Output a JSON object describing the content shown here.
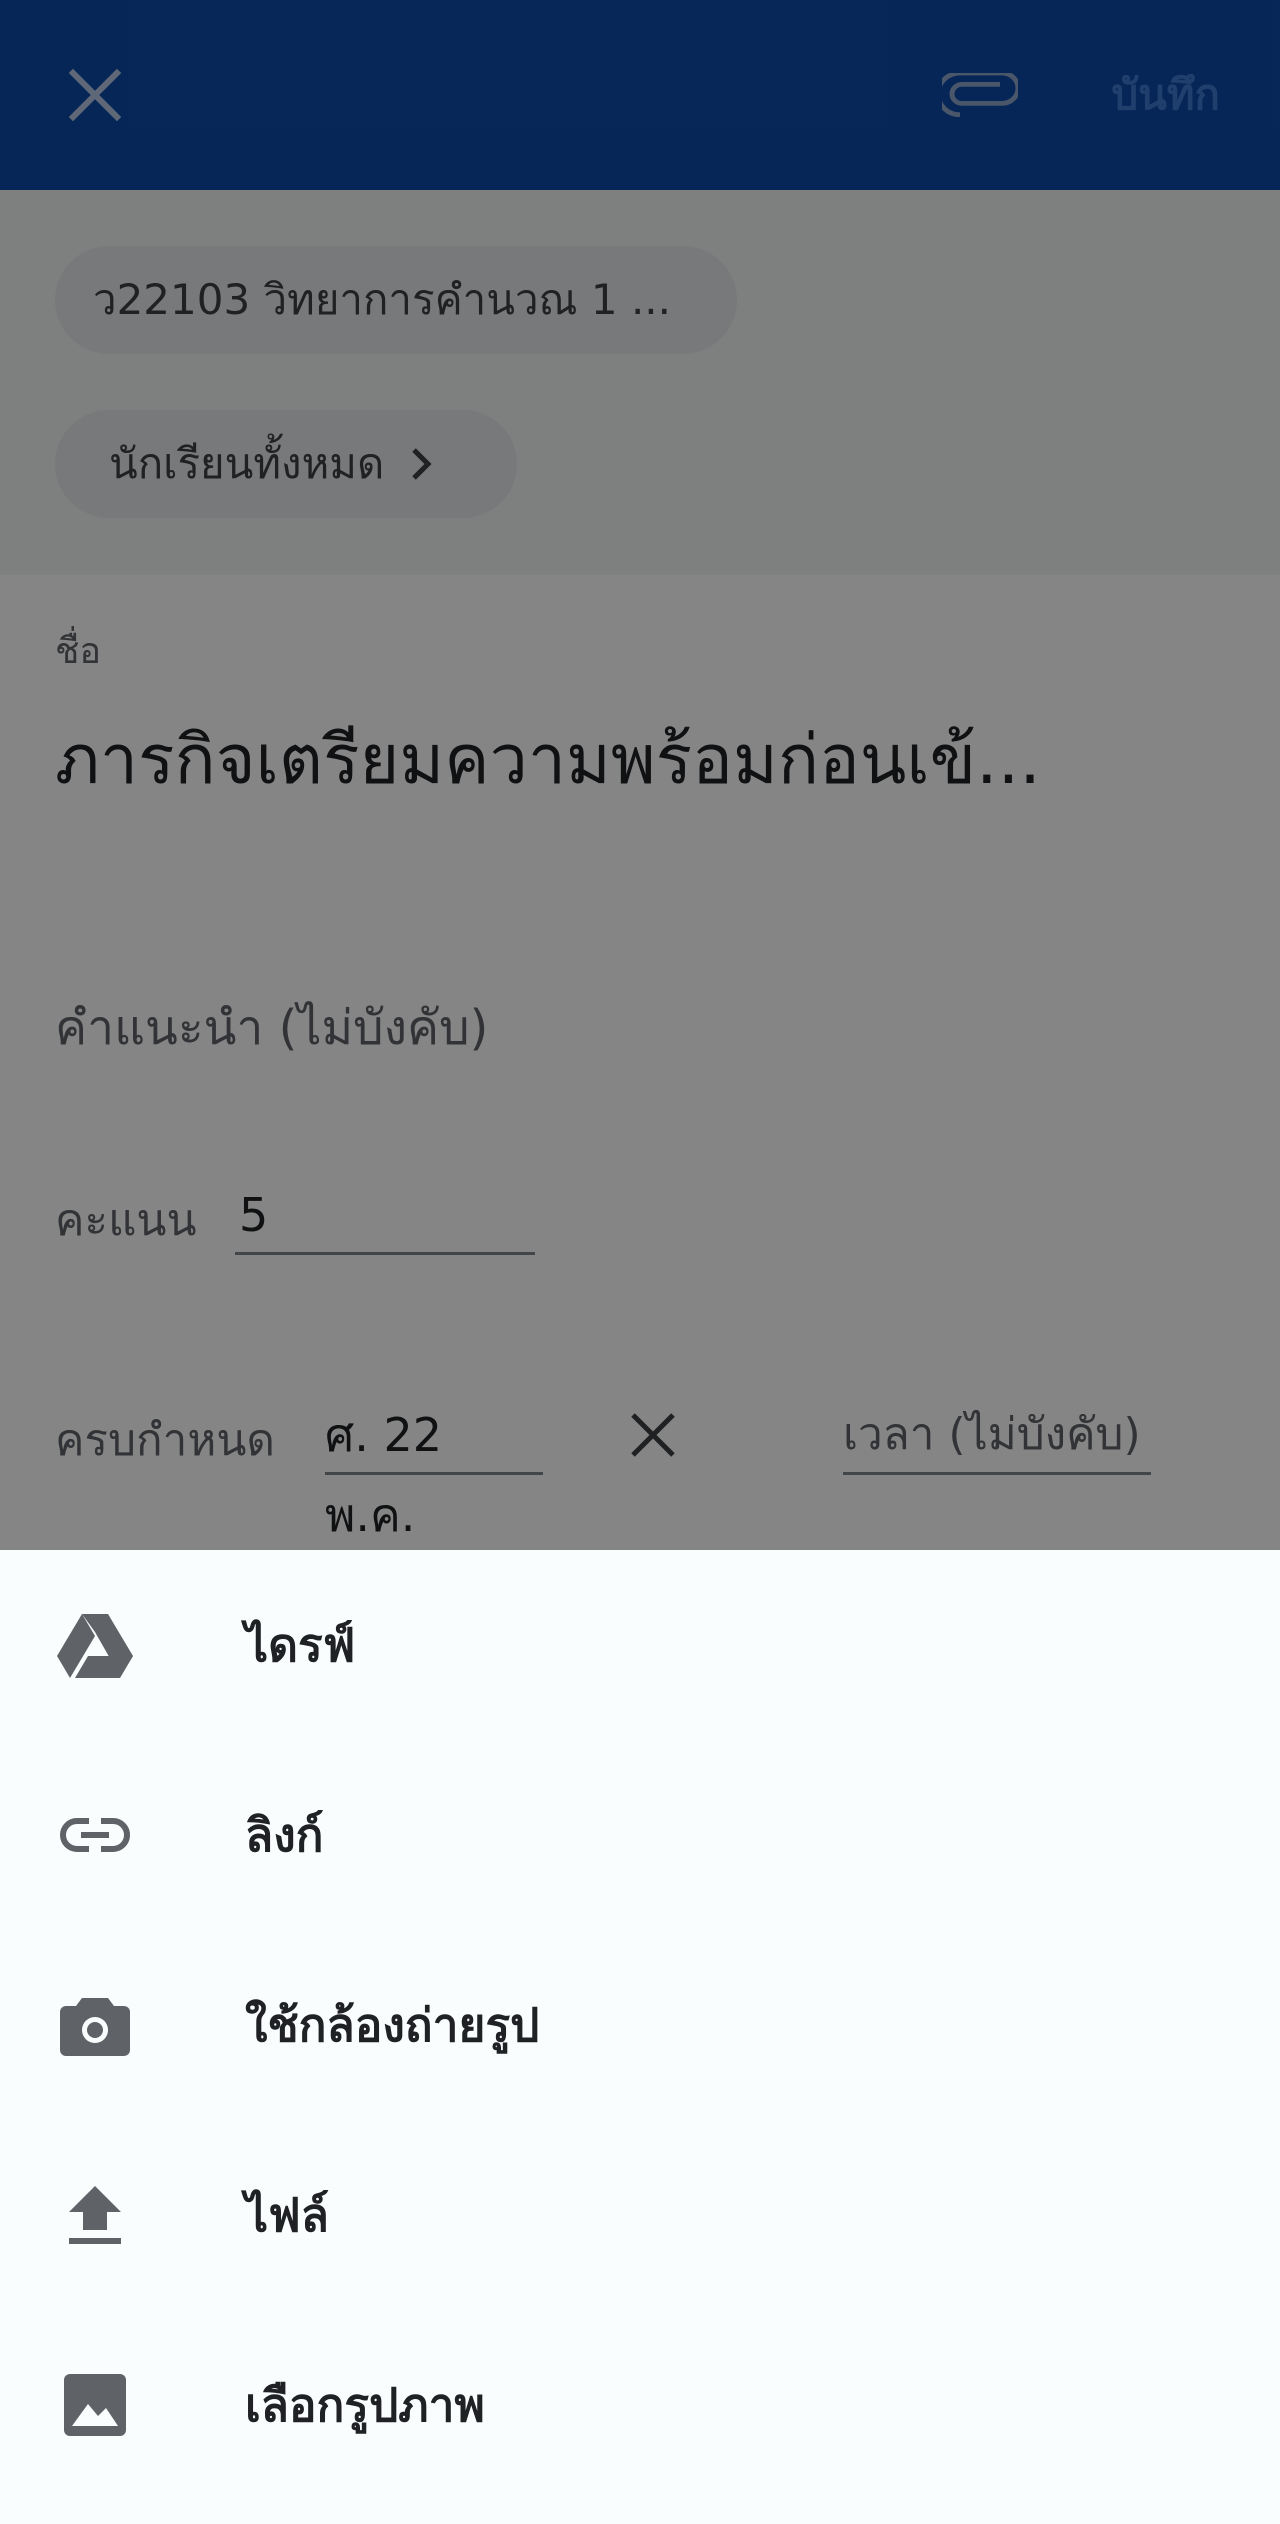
{
  "appbar": {
    "close_icon": "close-icon",
    "attach_icon": "paperclip-icon",
    "save_label": "บันทึก"
  },
  "header": {
    "course_chip": "ว22103 วิทยาการคำนวณ 1 ...",
    "students_chip": "นักเรียนทั้งหมด"
  },
  "form": {
    "title_label": "ชื่อ",
    "title_value": "ภารกิจเตรียมความพร้อมก่อนเข้...",
    "instructions_placeholder": "คำแนะนำ (ไม่บังคับ)",
    "points_label": "คะแนน",
    "points_value": "5",
    "due_label": "ครบกำหนด",
    "due_date": "ศ. 22 พ.ค.",
    "due_time_placeholder": "เวลา (ไม่บังคับ)"
  },
  "sheet": {
    "items": [
      {
        "label": "ไดรฟ์",
        "icon": "drive-icon"
      },
      {
        "label": "ลิงก์",
        "icon": "link-icon"
      },
      {
        "label": "ใช้กล้องถ่ายรูป",
        "icon": "camera-icon"
      },
      {
        "label": "ไฟล์",
        "icon": "upload-icon"
      },
      {
        "label": "เลือกรูปภาพ",
        "icon": "image-icon"
      }
    ]
  },
  "colors": {
    "appbar": "#0b4aa8",
    "sheet_bg": "#fafdfd",
    "icon_gray": "#5f6368"
  }
}
